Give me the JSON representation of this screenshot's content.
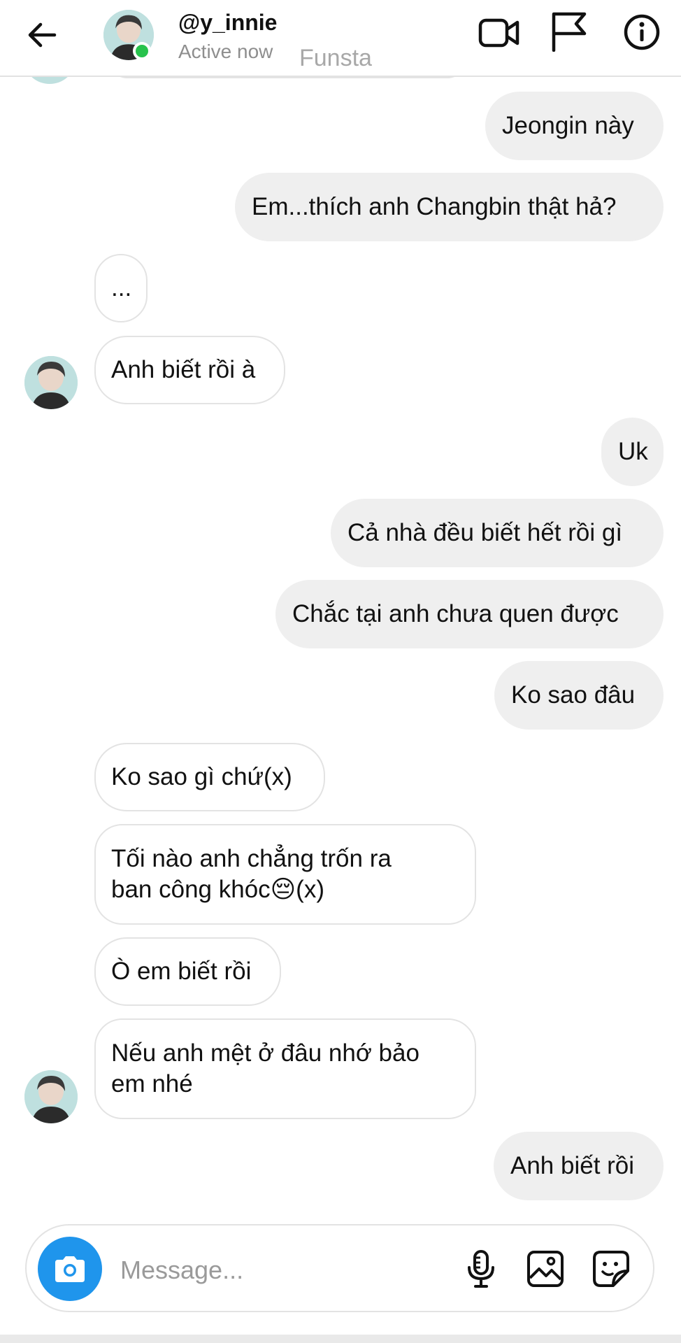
{
  "header": {
    "username": "@y_innie",
    "status": "Active now",
    "watermark": "Funsta",
    "icons": [
      "back-arrow-icon",
      "video-camera-icon",
      "flag-icon",
      "info-icon"
    ]
  },
  "messages": [
    {
      "side": "out",
      "text": "Jeongin này"
    },
    {
      "side": "out",
      "text": "Em...thích anh Changbin thật hả?"
    },
    {
      "side": "in",
      "text": "..."
    },
    {
      "side": "in",
      "text": "Anh biết rồi à"
    },
    {
      "side": "out",
      "text": "Uk"
    },
    {
      "side": "out",
      "text": "Cả nhà đều biết hết rồi gì"
    },
    {
      "side": "out",
      "text": "Chắc tại anh chưa quen được"
    },
    {
      "side": "out",
      "text": "Ko sao đâu"
    },
    {
      "side": "in",
      "text": "Ko sao gì chứ(x)"
    },
    {
      "side": "in",
      "lines": [
        "Tối nào anh chẳng trốn ra",
        "ban công khóc😔(x)"
      ]
    },
    {
      "side": "in",
      "text": "Ò em biết rồi"
    },
    {
      "side": "in",
      "lines": [
        "Nếu anh mệt ở đâu nhớ bảo",
        "em nhé"
      ]
    },
    {
      "side": "out",
      "text": "Anh biết rồi"
    }
  ],
  "composer": {
    "placeholder": "Message...",
    "icons": [
      "camera-icon",
      "microphone-icon",
      "gallery-icon",
      "sticker-icon"
    ]
  },
  "colors": {
    "outgoing_bubble": "#efefef",
    "incoming_border": "#e3e3e3",
    "camera_button": "#1f95ec",
    "online_dot": "#27c24c"
  }
}
